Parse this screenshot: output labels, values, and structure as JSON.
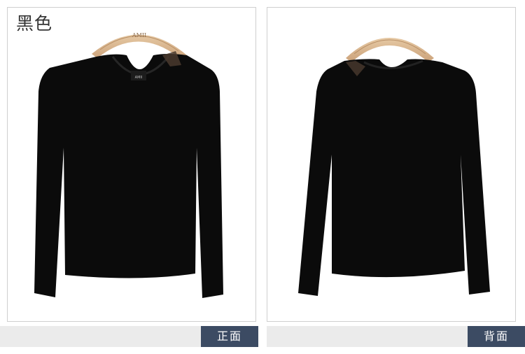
{
  "product": {
    "color_label": "黑色",
    "hanger_brand": "AMII",
    "neck_label_brand": "AMII"
  },
  "views": {
    "front_label": "正面",
    "back_label": "背面"
  },
  "colors": {
    "garment": "#0b0b0b",
    "hanger": "#d9b78f",
    "tag_bg": "#3c4b63",
    "bar_bg": "#ebebeb"
  }
}
